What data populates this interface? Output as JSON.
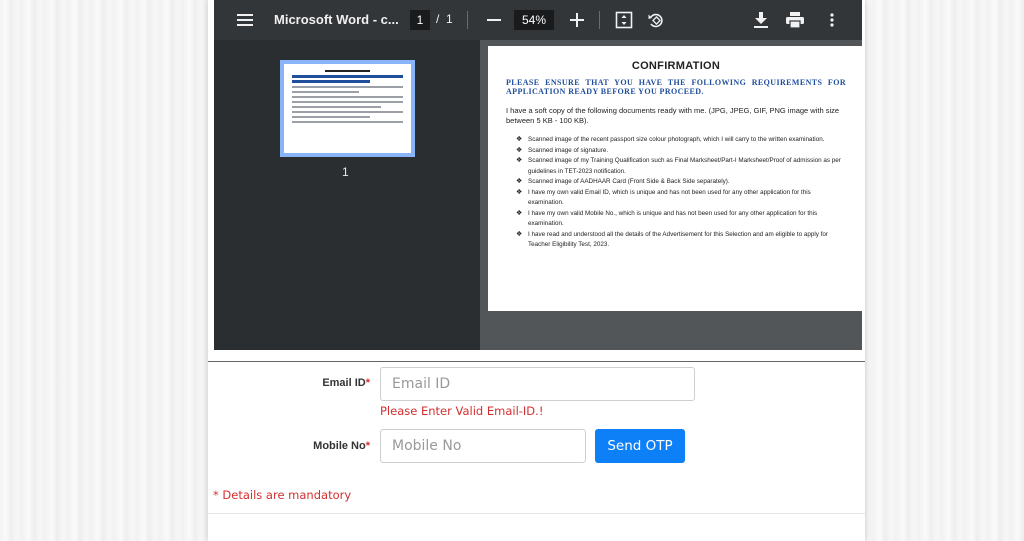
{
  "viewer": {
    "title": "Microsoft Word - c...",
    "current_page": "1",
    "page_separator": "/",
    "total_pages": "1",
    "zoom": "54%",
    "thumbnail_label": "1",
    "icons": [
      "menu-icon",
      "zoom-out-icon",
      "zoom-in-icon",
      "fit-page-icon",
      "rotate-icon",
      "download-icon",
      "print-icon",
      "more-vert-icon"
    ]
  },
  "document": {
    "title": "CONFIRMATION",
    "heading": "Please ensure that you have the following requirements for application ready before you proceed.",
    "intro": "I have a soft copy of the following documents ready with me. (JPG, JPEG, GIF, PNG image with size between 5 KB - 100 KB).",
    "bullets": [
      "Scanned image of the recent passport size colour photograph, which I will carry to the written examination.",
      "Scanned image of signature.",
      "Scanned image of my Training Qualification such as Final Marksheet/Part-I Marksheet/Proof of admission as per guidelines in TET-2023 notification.",
      "Scanned image of AADHAAR Card (Front Side & Back Side separately).",
      "I have my own valid Email ID, which is unique and has not been used for any other application for this examination.",
      "I have my own valid Mobile No., which is unique and has not been used for any other application for this examination.",
      "I have read and understood all the details of the Advertisement for this Selection and am eligible to apply for Teacher Eligibility Test, 2023."
    ]
  },
  "form": {
    "email_label": "Email ID",
    "email_placeholder": "Email ID",
    "email_error": "Please Enter Valid Email-ID.!",
    "mobile_label": "Mobile No",
    "mobile_placeholder": "Mobile No",
    "required_mark": "*",
    "send_otp": "Send OTP",
    "mandatory_note": "* Details are mandatory"
  },
  "colors": {
    "accent": "#0d7ff7",
    "error": "#d32f2f",
    "toolbar": "#323639",
    "heading_blue": "#1f4e9c"
  }
}
